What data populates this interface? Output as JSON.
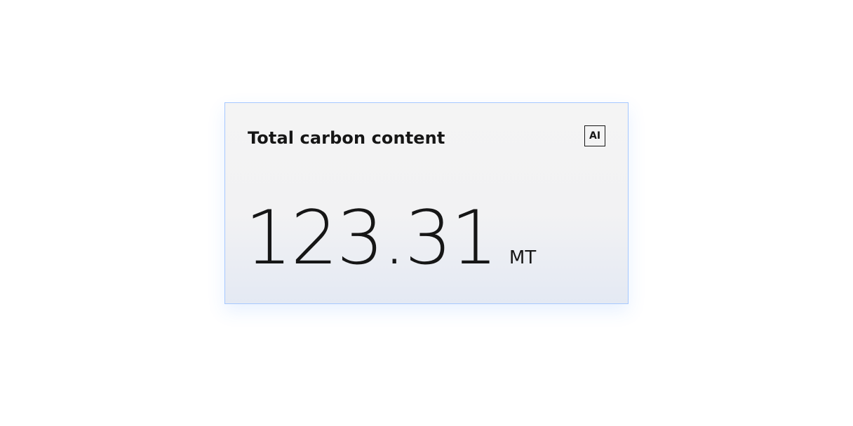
{
  "tile": {
    "title": "Total carbon content",
    "ai_label": "AI",
    "value": "123.31",
    "unit": "MT"
  },
  "colors": {
    "border": "#a6c8ff",
    "text": "#161616",
    "background_top": "#f4f4f4",
    "background_bottom": "#e4e9f3"
  }
}
